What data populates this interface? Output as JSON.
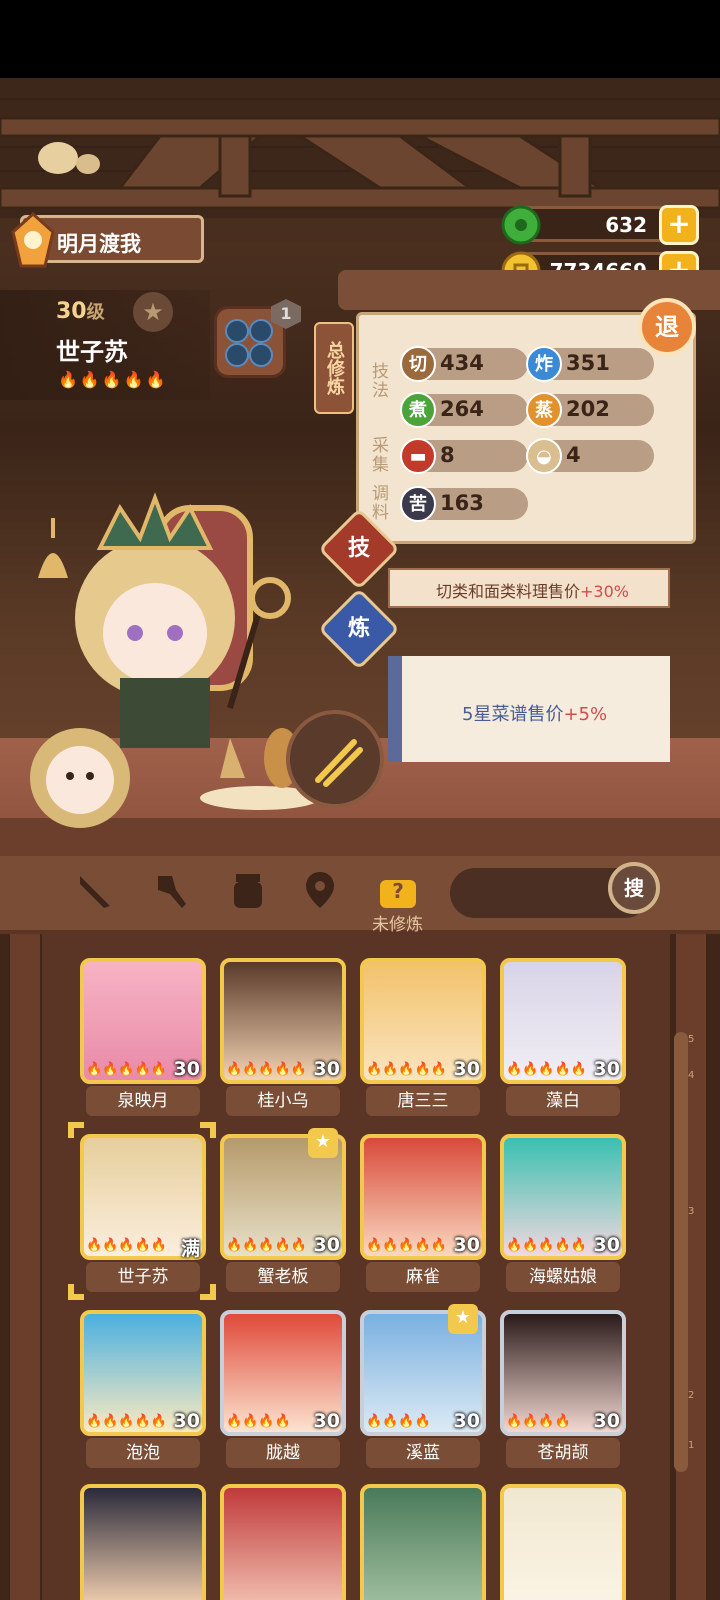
{
  "player": {
    "name": "明月渡我"
  },
  "currency": {
    "jade": "632",
    "coins": "7734669",
    "plus": "+"
  },
  "character": {
    "level": "30",
    "level_unit": "级",
    "name": "世子苏",
    "badge_count": "1"
  },
  "panel": {
    "tab_label": "总修炼",
    "section_skill": "技法",
    "section_gather": "采集",
    "section_season": "调料",
    "stats": [
      {
        "icon": "切",
        "value": "434"
      },
      {
        "icon": "炸",
        "value": "351"
      },
      {
        "icon": "煮",
        "value": "264"
      },
      {
        "icon": "蒸",
        "value": "202"
      },
      {
        "icon": "",
        "value": "8"
      },
      {
        "icon": "",
        "value": "4"
      },
      {
        "icon": "苦",
        "value": "163"
      }
    ],
    "quit": "退",
    "skill_tab": "技",
    "train_tab": "炼",
    "skill_text": "切类和面类料理售价",
    "skill_bonus": "+30%",
    "train_text": "5星菜谱售价",
    "train_bonus": "+5%"
  },
  "tabs": {
    "active_label": "未修炼",
    "search_btn": "搜"
  },
  "scale_ticks": [
    "5",
    "4",
    "3",
    "2",
    "1"
  ],
  "cards": [
    {
      "name": "泉映月",
      "level": "30"
    },
    {
      "name": "桂小乌",
      "level": "30"
    },
    {
      "name": "唐三三",
      "level": "30"
    },
    {
      "name": "藻白",
      "level": "30"
    },
    {
      "name": "世子苏",
      "level": "满"
    },
    {
      "name": "蟹老板",
      "level": "30"
    },
    {
      "name": "麻雀",
      "level": "30"
    },
    {
      "name": "海螺姑娘",
      "level": "30"
    },
    {
      "name": "泡泡",
      "level": "30"
    },
    {
      "name": "胧越",
      "level": "30"
    },
    {
      "name": "溪蓝",
      "level": "30"
    },
    {
      "name": "苍胡颉",
      "level": "30"
    }
  ],
  "colors": {
    "gold": "#f2c94c",
    "brown": "#7a4d36",
    "accent_red": "#d64a4a"
  }
}
